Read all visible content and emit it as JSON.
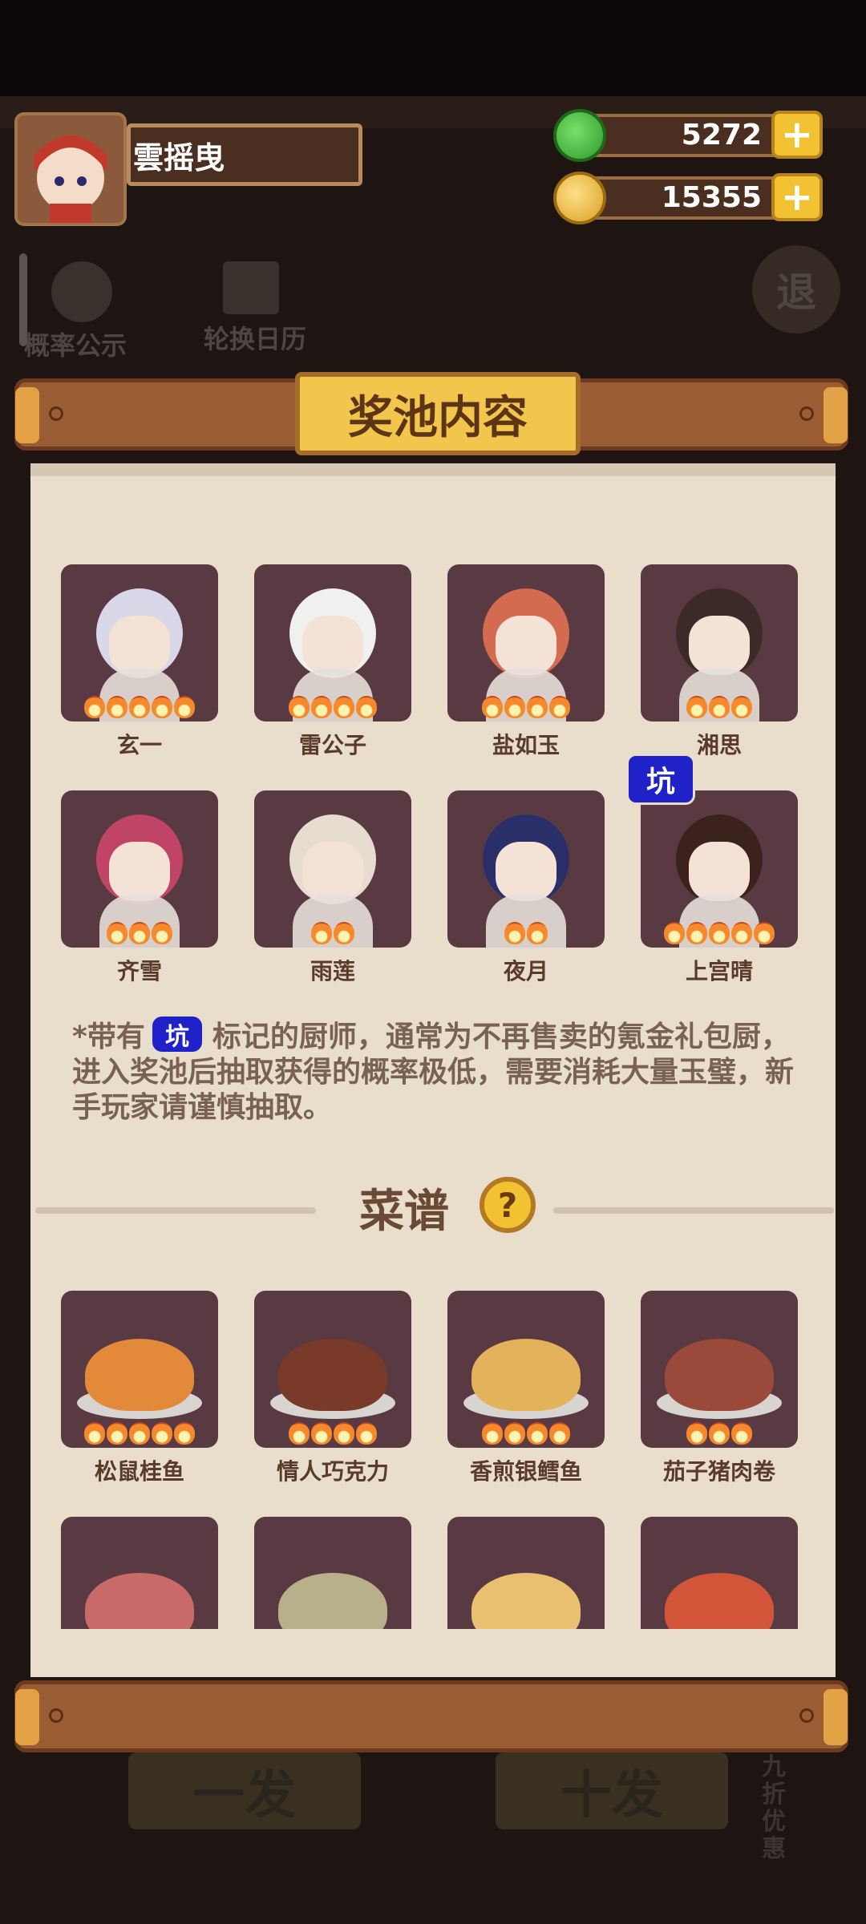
{
  "player": {
    "name": "雲摇曳",
    "avatar_icon": "chef-avatar-icon"
  },
  "currencies": [
    {
      "name": "jade",
      "icon": "jade-icon",
      "value": "5272",
      "plus": "+"
    },
    {
      "name": "coin",
      "icon": "coin-icon",
      "value": "15355",
      "plus": "+"
    }
  ],
  "background": {
    "rate_btn": "概率公示",
    "calendar_btn": "轮换日历",
    "exit_btn": "退",
    "single_draw": "一发",
    "ten_draw": "十发",
    "discount": "九折优惠"
  },
  "panel": {
    "title": "奖池内容",
    "chefs": [
      {
        "name": "玄一",
        "stars": 5,
        "keng": false
      },
      {
        "name": "雷公子",
        "stars": 4,
        "keng": false
      },
      {
        "name": "盐如玉",
        "stars": 4,
        "keng": false
      },
      {
        "name": "湘思",
        "stars": 3,
        "keng": false
      },
      {
        "name": "齐雪",
        "stars": 3,
        "keng": false
      },
      {
        "name": "雨莲",
        "stars": 2,
        "keng": false
      },
      {
        "name": "夜月",
        "stars": 2,
        "keng": false
      },
      {
        "name": "上宫晴",
        "stars": 5,
        "keng": true
      }
    ],
    "keng_label": "坑",
    "note_prefix": "*带有",
    "note_text": "标记的厨师，通常为不再售卖的氪金礼包厨，进入奖池后抽取获得的概率极低，需要消耗大量玉璧，新手玩家请谨慎抽取。",
    "recipes_title": "菜谱",
    "help_icon": "?",
    "recipes": [
      {
        "name": "松鼠桂鱼",
        "stars": 5
      },
      {
        "name": "情人巧克力",
        "stars": 4
      },
      {
        "name": "香煎银鳕鱼",
        "stars": 4
      },
      {
        "name": "茄子猪肉卷",
        "stars": 3
      }
    ]
  },
  "colors": {
    "keng": "#1e22c8",
    "paper": "#e9ddcc",
    "card": "#5a3a42",
    "gold": "#f2c64c"
  }
}
